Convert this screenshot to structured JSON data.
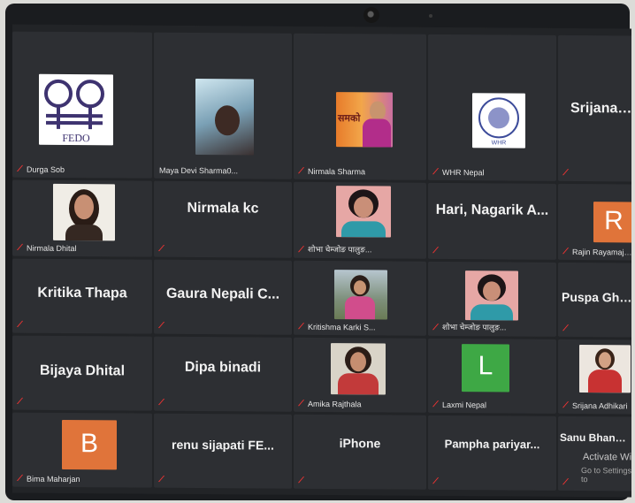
{
  "tiles": [
    {
      "label": "Durga Sob"
    },
    {
      "label": "Maya Devi Sharma0..."
    },
    {
      "label": "Nirmala Sharma"
    },
    {
      "label": "WHR Nepal"
    },
    {
      "name": "Srijana Sa"
    },
    {
      "label": "Nirmala Dhital"
    },
    {
      "name": "Nirmala kc"
    },
    {
      "label": "शोभा चेम्जोङ पालुङ..."
    },
    {
      "name": "Hari, Nagarik A..."
    },
    {
      "label": "Rajin Rayamajhi (..."
    },
    {
      "name": "Kritika Thapa"
    },
    {
      "name": "Gaura Nepali C..."
    },
    {
      "label": "Kritishma Karki S..."
    },
    {
      "label": "शोभा चेम्जोङ पालुङ..."
    },
    {
      "name": "Puspa Ghim"
    },
    {
      "name": "Bijaya Dhital"
    },
    {
      "name": "Dipa binadi"
    },
    {
      "label": "Amika Rajthala"
    },
    {
      "label": "Laxmi Nepal"
    },
    {
      "label": "Srijana Adhikari"
    },
    {
      "label": "Bima Maharjan"
    },
    {
      "name": "renu sijapati FE..."
    },
    {
      "name": "iPhone"
    },
    {
      "name": "Pampha pariyar..."
    },
    {
      "name": "Sanu Bhandari"
    }
  ],
  "avatars": {
    "R": "R",
    "L": "L",
    "B": "B"
  },
  "logos": {
    "fedo": "FEDO",
    "whr": "WHR",
    "samakon": "समको"
  },
  "watermark": {
    "line1": "Activate Wi",
    "line2": "Go to Settings to"
  },
  "colors": {
    "orange": "#e0743a",
    "green": "#3ea845",
    "tile": "#2d2f33",
    "screen": "#222427"
  }
}
